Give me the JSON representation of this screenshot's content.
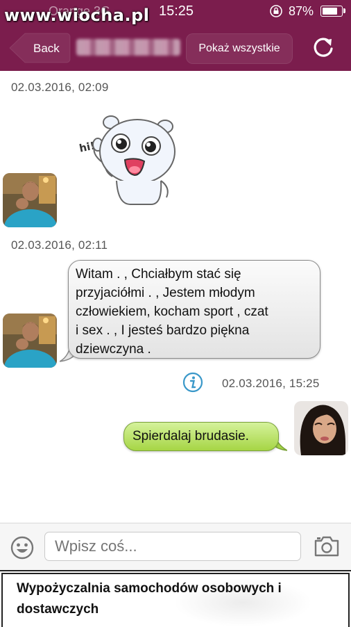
{
  "status_bar": {
    "watermark": "www.wiocha.pl",
    "carrier": "Orange  3G",
    "time": "15:25",
    "battery": "87%",
    "battery_level": 0.87
  },
  "nav": {
    "back_label": "Back",
    "show_all_label": "Pokaż wszystkie",
    "refresh_icon": "refresh-icon"
  },
  "messages": [
    {
      "timestamp": "02.03.2016, 02:09",
      "type": "sticker",
      "sticker_text": "hi!",
      "direction": "incoming"
    },
    {
      "timestamp": "02.03.2016, 02:11",
      "type": "text",
      "direction": "incoming",
      "lines": [
        "Witam . , Chciałbym stać się",
        "przyjaciółmi . , Jestem młodym",
        "człowiekiem, kocham sport , czat",
        "i sex . , I jesteś bardzo piękna",
        "dziewczyna ."
      ]
    },
    {
      "timestamp": "02.03.2016, 15:25",
      "type": "text",
      "direction": "outgoing",
      "text": "Spierdalaj brudasie.",
      "info_icon": "info-icon"
    }
  ],
  "input": {
    "placeholder": "Wpisz coś...",
    "emoji_icon": "emoji-icon",
    "camera_icon": "camera-icon"
  },
  "ad": {
    "lines": [
      "Wypożyczalnia samochodów osobowych i",
      "dostawczych"
    ]
  },
  "colors": {
    "header": "#7b1d4d",
    "incoming_bubble": "#eeeeee",
    "outgoing_bubble": "#b5de5e",
    "info_icon": "#3a98c9"
  }
}
